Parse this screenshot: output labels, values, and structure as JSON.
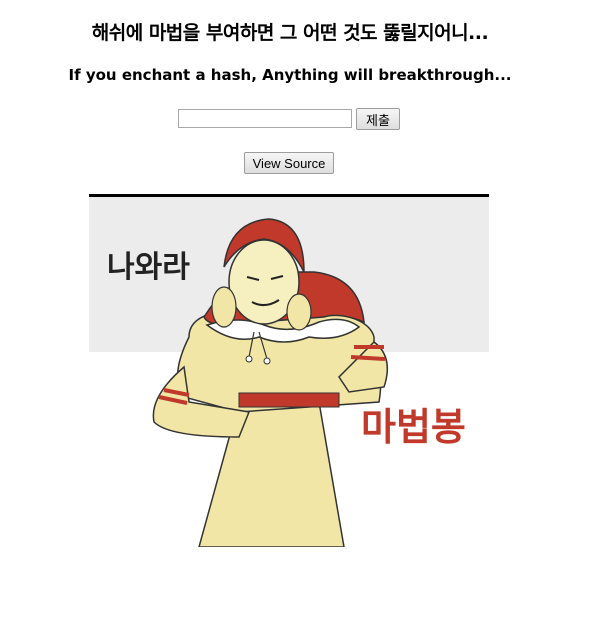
{
  "header": {
    "title": "해쉬에 마법을 부여하면 그 어떤 것도 뚫릴지어니...",
    "subtitle": "If you enchant a hash, Anything will breakthrough..."
  },
  "form": {
    "hash_input_value": "",
    "submit_label": "제출"
  },
  "view_source_label": "View Source",
  "meme": {
    "top_text": "나와라",
    "bottom_text": "마법봉",
    "bottom_text_color": "#c0392b",
    "cloak_color": "#c0392b",
    "dress_color": "#f1e6a6",
    "background_color": "#ececec"
  }
}
